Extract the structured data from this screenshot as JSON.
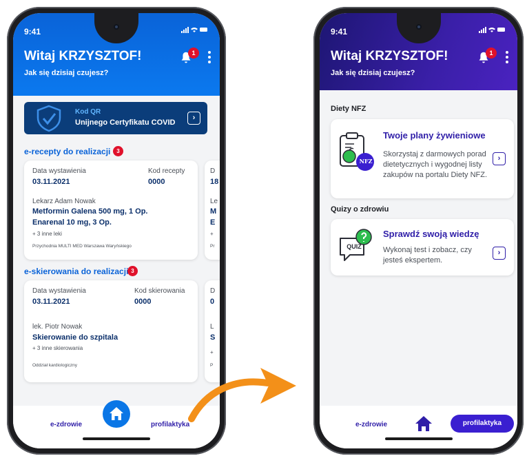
{
  "left_phone": {
    "status_time": "9:41",
    "greeting": "Witaj KRZYSZTOF!",
    "subtitle": "Jak się dzisiaj czujesz?",
    "notification_count": "1",
    "qr": {
      "line1": "Kod QR",
      "line2": "Unijnego Certyfikatu COVID"
    },
    "prescriptions": {
      "title": "e-recepty do realizacji",
      "count": "3",
      "card": {
        "date_label": "Data wystawienia",
        "date": "03.11.2021",
        "code_label": "Kod recepty",
        "code": "0000",
        "doctor": "Lekarz Adam Nowak",
        "drug1": "Metformin Galena 500 mg, 1 Op.",
        "drug2": "Enarenal 10 mg, 3 Op.",
        "more": "+ 3 inne leki",
        "clinic": "Przychodnia MULTI MED Warszawa Waryńskiego"
      },
      "peek": {
        "a": "D",
        "b": "18",
        "c": "Le",
        "d": "M",
        "e": "E",
        "f": "+",
        "g": "Pr"
      }
    },
    "referrals": {
      "title": "e-skierowania do realizacji",
      "count": "3",
      "card": {
        "date_label": "Data wystawienia",
        "date": "03.11.2021",
        "code_label": "Kod skierowania",
        "code": "0000",
        "doctor": "lek. Piotr Nowak",
        "referral": "Skierowanie do szpitala",
        "more": "+ 3 inne skierowania",
        "dept": "Oddział kardiologiczny"
      },
      "peek": {
        "a": "D",
        "b": "0",
        "c": "L",
        "d": "S",
        "e": "+",
        "f": "P"
      }
    },
    "nav": {
      "left": "e-zdrowie",
      "right": "profilaktyka"
    }
  },
  "right_phone": {
    "status_time": "9:41",
    "greeting": "Witaj KRZYSZTOF!",
    "subtitle": "Jak się dzisiaj czujesz?",
    "notification_count": "1",
    "diets": {
      "section": "Diety NFZ",
      "card_title": "Twoje plany żywieniowe",
      "desc": "Skorzystaj z darmowych porad dietetycznych i wygodnej listy zakupów na portalu Diety NFZ.",
      "logo_text": "NFZ"
    },
    "quiz": {
      "section": "Quizy o zdrowiu",
      "card_title": "Sprawdź swoją wiedzę",
      "desc": "Wykonaj test i zobacz, czy jesteś ekspertem.",
      "icon_text": "QUIZ"
    },
    "nav": {
      "left": "e-zdrowie",
      "right": "profilaktyka"
    }
  },
  "colors": {
    "blue_header": "#0a63d8",
    "purple_header": "#3a1fa8",
    "badge_red": "#e0112b",
    "arrow_orange": "#f39019",
    "qr_navy": "#0b3d7a"
  }
}
